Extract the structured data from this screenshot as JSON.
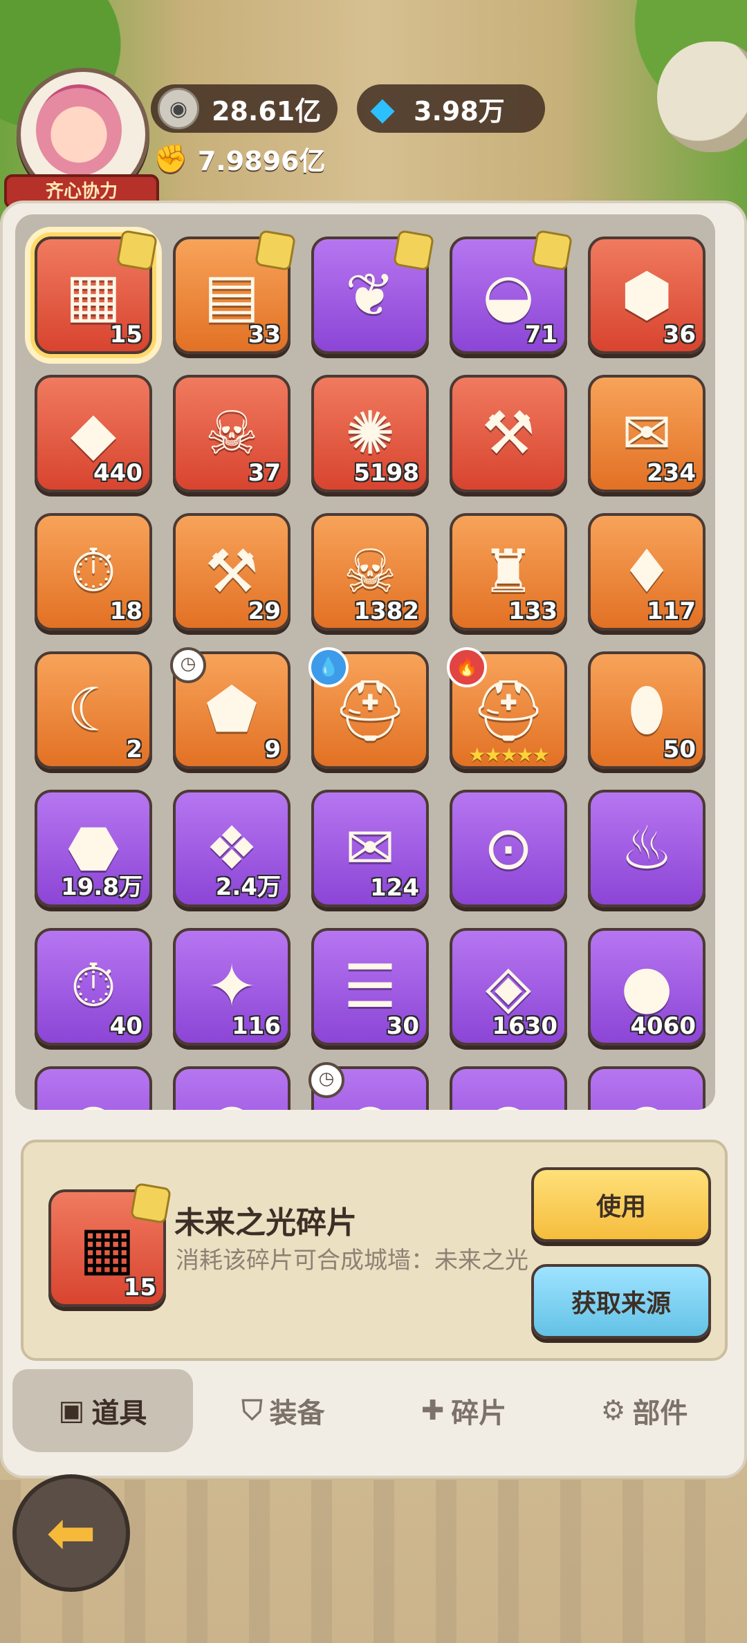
{
  "header": {
    "avatar_banner": "齐心协力",
    "coins": "28.61亿",
    "gems": "3.98万",
    "power": "7.9896亿",
    "coin_icon": "coin-icon",
    "gem_icon": "diamond-icon",
    "power_icon": "fist-icon"
  },
  "inventory": {
    "items": [
      {
        "qty": "15",
        "color": "red",
        "icon": "crystal-wall-shard",
        "badge": "puzzle",
        "selected": true
      },
      {
        "qty": "33",
        "color": "orange",
        "icon": "net-wall-shard",
        "badge": "puzzle"
      },
      {
        "qty": "",
        "color": "purple",
        "icon": "garden-shard",
        "badge": "puzzle"
      },
      {
        "qty": "71",
        "color": "purple",
        "icon": "fruit-pool-shard",
        "badge": "puzzle"
      },
      {
        "qty": "36",
        "color": "red",
        "icon": "prism-gem"
      },
      {
        "qty": "440",
        "color": "red",
        "icon": "ice-crystal"
      },
      {
        "qty": "37",
        "color": "red",
        "icon": "dragon-skull"
      },
      {
        "qty": "5198",
        "color": "red",
        "icon": "shield-emblem"
      },
      {
        "qty": "",
        "color": "red",
        "icon": "golden-shovel"
      },
      {
        "qty": "234",
        "color": "orange",
        "icon": "golden-ticket"
      },
      {
        "qty": "18",
        "color": "orange",
        "icon": "speedup-1h"
      },
      {
        "qty": "29",
        "color": "orange",
        "icon": "stone-hammer"
      },
      {
        "qty": "1382",
        "color": "orange",
        "icon": "beast-skull"
      },
      {
        "qty": "133",
        "color": "orange",
        "icon": "castle-scroll"
      },
      {
        "qty": "117",
        "color": "orange",
        "icon": "pink-crystal-ore"
      },
      {
        "qty": "2",
        "color": "orange",
        "icon": "crescent-gem"
      },
      {
        "qty": "9",
        "color": "orange",
        "icon": "blue-shield-crystal",
        "badge": "clock"
      },
      {
        "qty": "",
        "color": "orange",
        "icon": "blue-helmet",
        "badge": "water"
      },
      {
        "qty": "",
        "color": "orange",
        "icon": "red-helmet",
        "badge": "fire",
        "stars": "★★★★★"
      },
      {
        "qty": "50",
        "color": "orange",
        "icon": "amber-egg"
      },
      {
        "qty": "19.8万",
        "color": "purple",
        "icon": "gold-ore"
      },
      {
        "qty": "2.4万",
        "color": "purple",
        "icon": "ice-ore"
      },
      {
        "qty": "124",
        "color": "purple",
        "icon": "blue-ticket"
      },
      {
        "qty": "",
        "color": "purple",
        "icon": "coin-sack"
      },
      {
        "qty": "",
        "color": "purple",
        "icon": "meat"
      },
      {
        "qty": "40",
        "color": "purple",
        "icon": "speedup-15m"
      },
      {
        "qty": "116",
        "color": "purple",
        "icon": "magenta-gem"
      },
      {
        "qty": "30",
        "color": "purple",
        "icon": "wood-logs"
      },
      {
        "qty": "1630",
        "color": "purple",
        "icon": "green-rune"
      },
      {
        "qty": "4060",
        "color": "purple",
        "icon": "blue-slime"
      },
      {
        "qty": "",
        "color": "purple",
        "icon": "partial-item"
      },
      {
        "qty": "",
        "color": "purple",
        "icon": "partial-item"
      },
      {
        "qty": "",
        "color": "purple",
        "icon": "partial-item",
        "badge": "clock"
      },
      {
        "qty": "",
        "color": "purple",
        "icon": "partial-item"
      },
      {
        "qty": "",
        "color": "purple",
        "icon": "partial-item"
      }
    ]
  },
  "detail": {
    "qty": "15",
    "title": "未来之光碎片",
    "description": "消耗该碎片可合成城墙：未来之光",
    "use_label": "使用",
    "source_label": "获取来源"
  },
  "tabs": [
    {
      "label": "道具",
      "icon": "item-icon",
      "active": true
    },
    {
      "label": "装备",
      "icon": "shield-icon"
    },
    {
      "label": "碎片",
      "icon": "puzzle-icon"
    },
    {
      "label": "部件",
      "icon": "gear-icon"
    }
  ],
  "colors": {
    "tile_orange": "#e27124",
    "tile_red": "#d8442f",
    "tile_purple": "#8c45d6",
    "use_button": "#f5bd3d",
    "source_button": "#63c2e6"
  }
}
